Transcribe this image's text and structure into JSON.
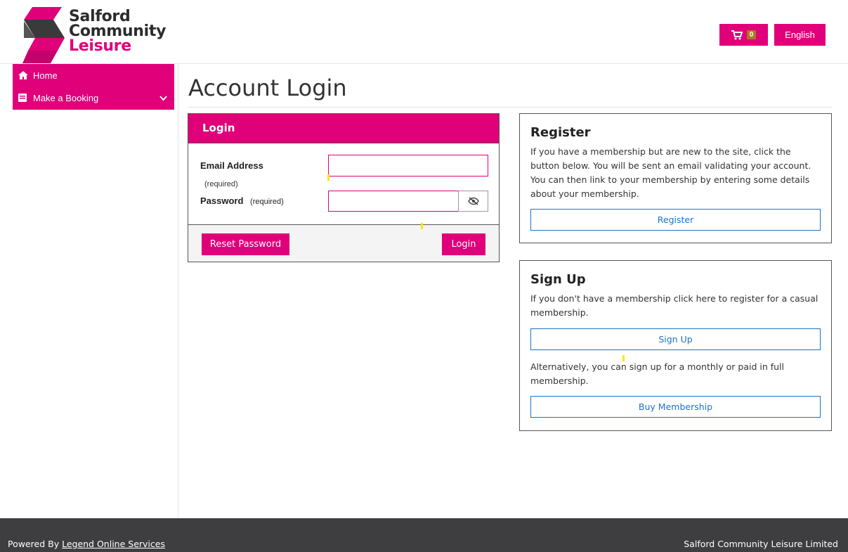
{
  "brand": {
    "line1": "Salford",
    "line2": "Community",
    "line3": "Leisure",
    "accent_color": "#e0007a"
  },
  "header": {
    "cart_icon": "shopping-cart-icon",
    "cart_count": "0",
    "language": "English"
  },
  "sidebar": {
    "items": [
      {
        "label": "Home",
        "icon": "home-icon"
      },
      {
        "label": "Make a Booking",
        "icon": "book-icon"
      }
    ]
  },
  "page": {
    "title": "Account Login"
  },
  "login": {
    "heading": "Login",
    "email_label": "Email Address",
    "email_required": "(required)",
    "email_value": "",
    "password_label": "Password",
    "password_required": "(required)",
    "password_value": "",
    "eye_icon": "eye-slash-icon",
    "reset_label": "Reset Password",
    "login_label": "Login"
  },
  "register": {
    "heading": "Register",
    "text": "If you have a membership but are new to the site, click the button below. You will be sent an email validating your account. You can then link to your membership by entering some details about your membership.",
    "button": "Register"
  },
  "signup": {
    "heading": "Sign Up",
    "text": "If you don't have a membership click here to register for a casual membership.",
    "button": "Sign Up",
    "alt_text": "Alternatively, you can sign up for a monthly or paid in full membership.",
    "buy_button": "Buy Membership"
  },
  "footer": {
    "powered_prefix": "Powered By ",
    "powered_link": "Legend Online Services",
    "company": "Salford Community Leisure Limited"
  }
}
